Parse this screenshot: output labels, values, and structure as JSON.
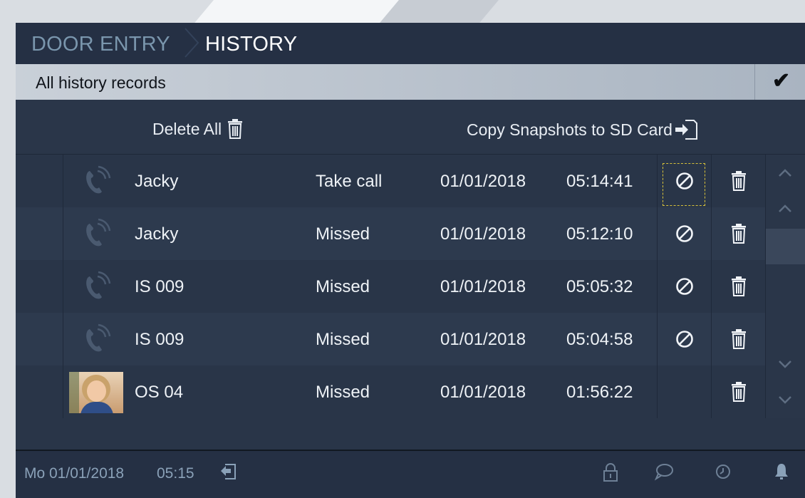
{
  "breadcrumb": {
    "section": "DOOR ENTRY",
    "page": "HISTORY"
  },
  "filter": {
    "label": "All history records",
    "confirm_icon": "checkmark-icon"
  },
  "actions": {
    "delete_all": "Delete All",
    "copy_snapshots": "Copy Snapshots to SD Card"
  },
  "records": [
    {
      "name": "Jacky",
      "status": "Take call",
      "date": "01/01/2018",
      "time": "05:14:41",
      "icon": "phone-icon",
      "blockable": true
    },
    {
      "name": "Jacky",
      "status": "Missed",
      "date": "01/01/2018",
      "time": "05:12:10",
      "icon": "phone-icon",
      "blockable": true
    },
    {
      "name": "IS 009",
      "status": "Missed",
      "date": "01/01/2018",
      "time": "05:05:32",
      "icon": "phone-icon",
      "blockable": true
    },
    {
      "name": "IS 009",
      "status": "Missed",
      "date": "01/01/2018",
      "time": "05:04:58",
      "icon": "phone-icon",
      "blockable": true
    },
    {
      "name": "OS 04",
      "status": "Missed",
      "date": "01/01/2018",
      "time": "01:56:22",
      "icon": "snapshot-thumbnail",
      "blockable": false
    }
  ],
  "footer": {
    "date": "Mo 01/01/2018",
    "time": "05:15"
  },
  "colors": {
    "focus": "#d8c23a",
    "screen_bg": "#293548",
    "muted_text": "#8aa1b8"
  }
}
